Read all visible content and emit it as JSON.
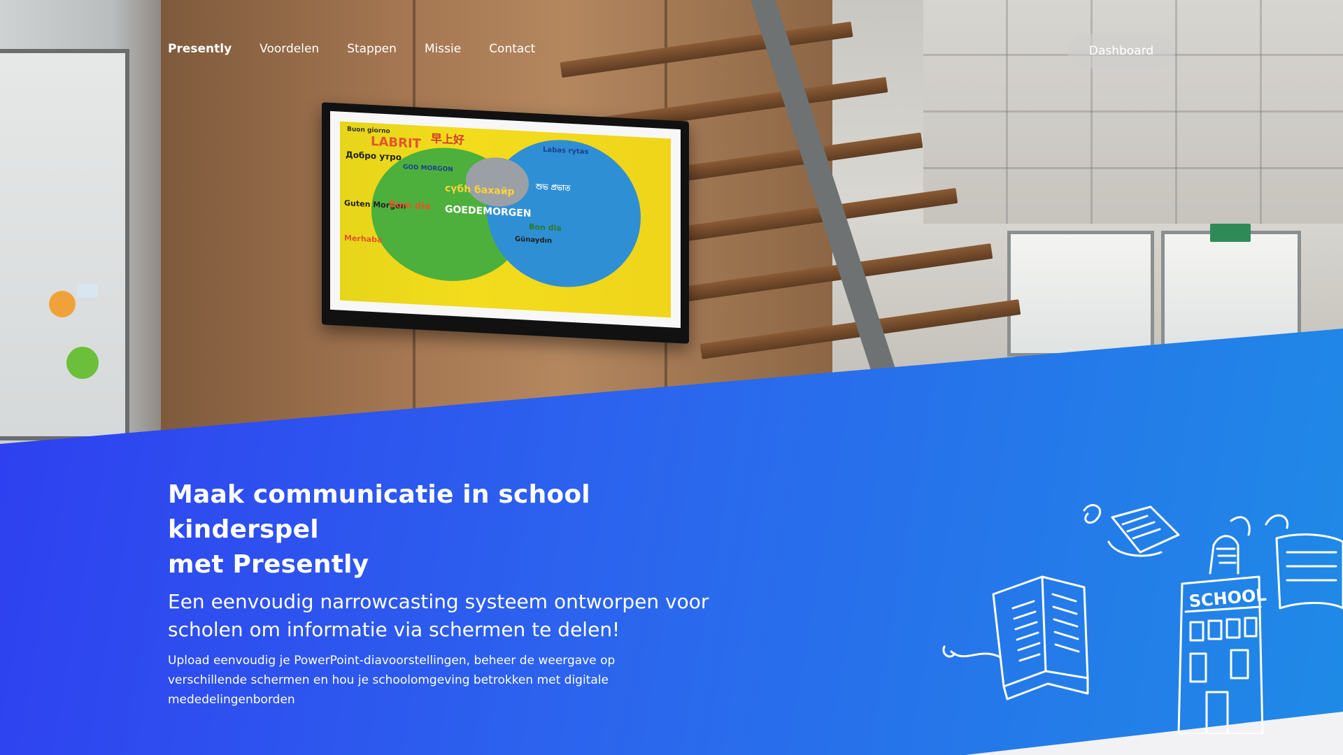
{
  "nav": {
    "brand": "Presently",
    "links": [
      "Voordelen",
      "Stappen",
      "Missie",
      "Contact"
    ],
    "dashboard_label": "Dashboard"
  },
  "hero": {
    "headline_line1": "Maak communicatie in school kinderspel",
    "headline_line2": "met Presently",
    "subheadline_line1": "Een eenvoudig narrowcasting systeem ontworpen voor",
    "subheadline_line2": "scholen om informatie via schermen te delen!",
    "body_line1": "Upload eenvoudig je PowerPoint-diavoorstellingen, beheer de weergave op",
    "body_line2": "verschillende schermen en hou je schoolomgeving betrokken met digitale",
    "body_line3": "mededelingenborden"
  },
  "tv_screen": {
    "words": [
      "Buon giorno",
      "LABRIT",
      "早上好",
      "Добро утро",
      "GOD MORGON",
      "GOEDEMORGEN",
      "Guten Morgen",
      "Bom dia",
      "Merhaba",
      "Günaydın",
      "Labas rytas",
      "Bon dia",
      "сүбһ бахайр",
      "শুভ প্রভাত"
    ]
  },
  "illustration": {
    "school_label": "SCHOOL"
  },
  "colors": {
    "blue_start": "#2f3cf0",
    "blue_end": "#1f8ae6",
    "text": "#ffffff"
  }
}
